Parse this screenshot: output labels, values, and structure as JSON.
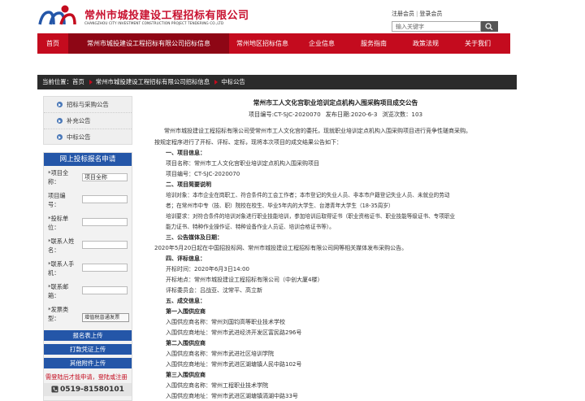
{
  "header": {
    "brand_cn": "常州市城投建设工程招标有限公司",
    "brand_en": "CHANGZHOU CITY INVESTMENT CONSTRUCTION PROJECT TENDERING CO.,LTD",
    "register": "注册会员",
    "login": "登录会员",
    "search_placeholder": "输入关键字",
    "logo_colors": [
      "#2456a8",
      "#c40b1e"
    ]
  },
  "nav": {
    "items": [
      {
        "label": "首页"
      },
      {
        "label": "常州市城投建设工程招标有限公司招标信息"
      },
      {
        "label": "常州地区招标信息"
      },
      {
        "label": "企业信息"
      },
      {
        "label": "服务指南"
      },
      {
        "label": "政策法规"
      },
      {
        "label": "关于我们"
      }
    ]
  },
  "breadcrumb": {
    "prefix": "当前位置：首页",
    "level1": "常州市城投建设工程招标有限公司招标信息",
    "level2": "中标公告"
  },
  "sidebar": {
    "items": [
      {
        "label": "招标与采购公告"
      },
      {
        "label": "补充公告"
      },
      {
        "label": "中标公告"
      }
    ]
  },
  "form": {
    "title": "网上投标报名申请",
    "fields": [
      {
        "label_top": "*项目全",
        "label_bottom": "称：",
        "value": "项目全称"
      },
      {
        "label_top": "项目编",
        "label_bottom": "号：",
        "value": ""
      },
      {
        "label_top": "*投标单",
        "label_bottom": "位：",
        "value": ""
      },
      {
        "label_top": "*联系人姓",
        "label_bottom": "名：",
        "value": ""
      },
      {
        "label_top": "*联系人手",
        "label_bottom": "机：",
        "value": ""
      },
      {
        "label_top": "*联系邮",
        "label_bottom": "箱：",
        "value": ""
      },
      {
        "label_top": "*发票类",
        "label_bottom": "型：",
        "value": "增值税普通发票"
      }
    ],
    "buttons": [
      "报名表上传",
      "打款凭证上传",
      "其他附件上传"
    ],
    "note": "需登陆后才能申请，登陆或注册",
    "phone": "0519-81580101"
  },
  "article": {
    "title": "常州市工人文化宫职业培训定点机构入围采购项目成交公告",
    "meta_code": "项目编号:CT-SJC-2020070",
    "meta_date": "发布日期:2020-6-3",
    "meta_views": "浏览次数：103",
    "lines": [
      "常州市城投建设工程招标有限公司受常州市工人文化宫的委托，现就职业培训定点机构入围采购项目进行竞争性磋商采购。",
      "按规定程序进行了开标、评标、定标，现将本次项目的成交结果公告如下：",
      "一、项目信息：",
      "项目名称：常州市工人文化宫职业培训定点机构入围采购项目",
      "项目编号：CT-SJC-2020070",
      "二、项目简要说明",
      "培训对象：本市企业在岗职工、符合条件的工会工作者；本市登记的失业人员、非本市户籍登记失业人员、未就业的劳动",
      "者；在常州市中专（技、职）院校在校生、毕业5年内的大学生、台港青年大学生（18-35周岁）",
      "培训要求：对符合条件的培训对象进行职业技能培训，参加培训后取得证书（职业资格证书、职业技能等级证书、专项职业",
      "能力证书、特种作业操作证、特种设备作业人员证、培训合格证书等）。",
      "三、公告媒体及日期：",
      "2020年5月20日起在中国招投标网、常州市城投建设工程招标有限公司网等相关媒体发布采购公告。",
      "四、评标信息：",
      "开标时间：2020年6月3日14:00",
      "开标地点：常州市城投建设工程招标有限公司（中创大厦4楼）",
      "评标委员会：吕战亚、沈常平、高立新",
      "五、成交信息：",
      "第一入围供应商",
      "入围供应商名称：常州刘国钧高等职业技术学校",
      "入围供应商地址：常州市武进经济开发区富民路296号",
      "第二入围供应商",
      "入围供应商名称：常州市武进社区培训学院",
      "入围供应商地址：常州市武进区湖塘镇人民中路102号",
      "第三入围供应商",
      "入围供应商名称：常州工程职业技术学院",
      "入围供应商地址：常州市武进区湖塘镇滆湖中路33号"
    ]
  }
}
